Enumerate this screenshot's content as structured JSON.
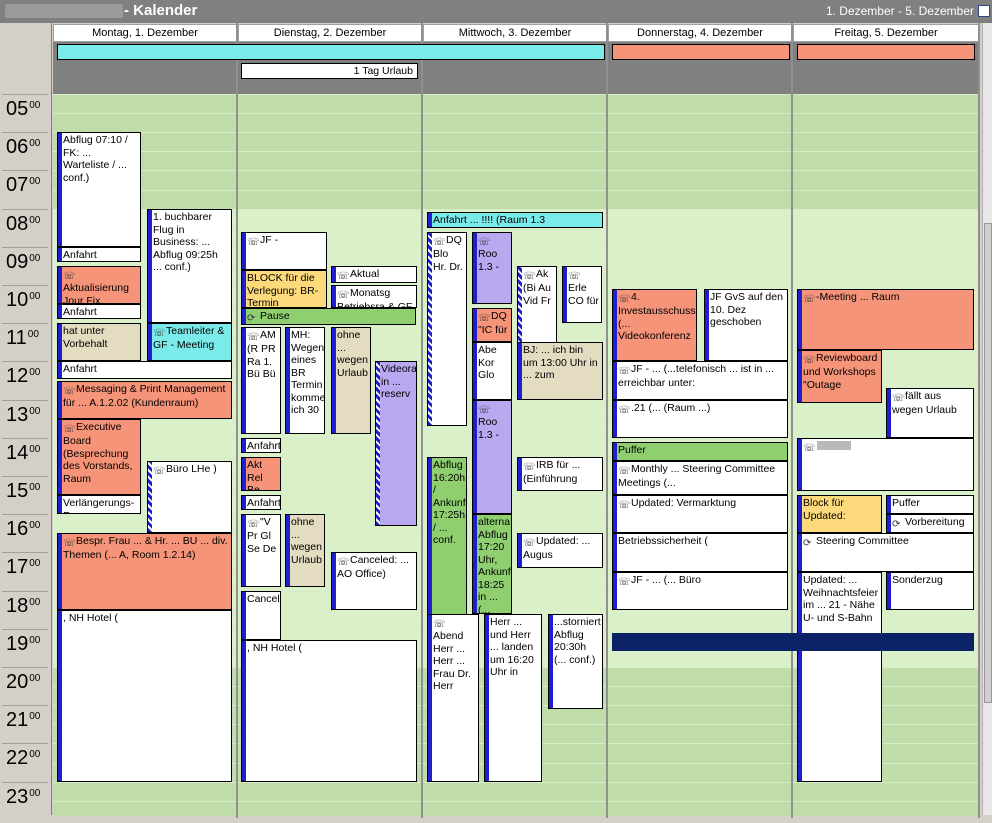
{
  "window": {
    "title": "- Kalender",
    "range": "1. Dezember - 5. Dezember"
  },
  "hours": [
    "05",
    "06",
    "07",
    "08",
    "09",
    "10",
    "11",
    "12",
    "13",
    "14",
    "15",
    "16",
    "17",
    "18",
    "19",
    "20",
    "21",
    "22",
    "23"
  ],
  "days": [
    {
      "header": "Montag, 1. Dezember"
    },
    {
      "header": "Dienstag, 2. Dezember"
    },
    {
      "header": "Mittwoch, 3. Dezember"
    },
    {
      "header": "Donnerstag, 4. Dezember"
    },
    {
      "header": "Freitag, 5. Dezember"
    }
  ],
  "allday": {
    "urlaub": "1 Tag Urlaub"
  },
  "events": {
    "mo_abflug": "Abflug 07:10 / FK: ... Warteliste / ... conf.)",
    "mo_anfahrt1": "Anfahrt",
    "mo_aktual": "Aktualisierung Jour Fix",
    "mo_anfahrt2": "Anfahrt",
    "mo_vorbehalt": "hat unter Vorbehalt",
    "mo_anfahrt3": "Anfahrt",
    "mo_messaging": "Messaging & Print Management für ... A.1.2.02 (Kundenraum)",
    "mo_board": "Executive Board (Besprechung des Vorstands, Raum",
    "mo_verl": "Verlängerungs-R",
    "mo_bespr": "Bespr. Frau ... & Hr. ... BU ... div. Themen (... A, Room 1.2.14)",
    "mo_hotel": ", NH Hotel (",
    "mo2_flug": "1. buchbarer Flug in Business: ... Abflug 09:25h ... conf.)",
    "mo2_team": "Teamleiter & GF - Meeting",
    "mo2_buero": "Büro LHe )",
    "di_jf": "JF -",
    "di_block": "BLOCK für die Verlegung: BR-Termin",
    "di_pause": "Pause",
    "di_am": "AM (R PR Ra 1. Bü Bü",
    "di_mh": "MH: Wegen eines BR Termin kommen ich 30",
    "di_ohne1": "ohne ... wegen Urlaub",
    "di_aktual": "Aktual",
    "di_monat": "Monatsg Betriebsra & GF",
    "di_video": "Videoraum in ... reserv",
    "di_anfahrt1": "Anfahrt",
    "di_akt2": "Akt Rel Be",
    "di_anfahrt2": "Anfahrt",
    "di_v": "\"V Pr Gl Se De",
    "di_ohne2": "ohne ... wegen Urlaub",
    "di_cancel": "Cancel",
    "di_canceled": "Canceled: ... AO Office)",
    "di_hotel": ", NH Hotel (",
    "mi_anfahrt": "Anfahrt ... !!!! (Raum 1.3",
    "mi_dq1": "DQ Blo Hr. Dr.",
    "mi_room1": "Roo 1.3 -",
    "mi_ak": "Ak (Bi Au Vid Fr",
    "mi_erl": "Erle CO für",
    "mi_dq2": "DQ \"IC für",
    "mi_abe": "Abe Kor Glo",
    "mi_bj": "BJ: ... ich bin um 13:00 Uhr in ... zum",
    "mi_room2": "Roo 1.3 -",
    "mi_abflug": "Abflug 16:20h / Ankunft 17:25h / ... conf.",
    "mi_alt": "alterna Abflug 17:20 Uhr, Ankunf 18:25 in ... (... conf)",
    "mi_irb": "IRB für ... (Einführung",
    "mi_updated": "Updated: ... Augus",
    "mi_abend": "Abend Herr ... Herr ... Frau Dr. Herr",
    "mi_herr": "Herr ... und Herr ... landen um 16:20 Uhr in",
    "mi_storn": "...storniert Abflug 20:30h (... conf.)",
    "do_invest": "4. Investausschuss (... Videokonferenz",
    "do_jfgvs": "JF GvS auf den 10. Dez geschoben",
    "do_jf1": "JF - ... (...telefonisch ... ist in ... erreichbar unter:",
    "do_raum": ".21 (... (Raum ...)",
    "do_puffer": "Puffer",
    "do_monthly": "Monthly ... Steering Committee Meetings (...",
    "do_updated": "Updated: Vermarktung",
    "do_betrieb": "Betriebssicherheit (",
    "do_jf2": "JF - ... (... Büro",
    "fr_meeting": "-Meeting ... Raum",
    "fr_review": "Reviewboard und Workshops \"Outage",
    "fr_faellt": "fällt aus wegen Urlaub",
    "fr_block": "Block für Updated:",
    "fr_puffer": "Puffer",
    "fr_vorb": "Vorbereitung",
    "fr_steer": "Steering Committee",
    "fr_updated": "Updated: ... Weihnachtsfeier im ... 21 - Nähe U- und S-Bahn",
    "fr_sonder": "Sonderzug"
  },
  "colors": {
    "salmon": "#f6947a",
    "cyan": "#7aeaea",
    "green": "#90cf70",
    "tan": "#e4dcc0",
    "purple": "#b8a8f0",
    "yellow": "#fcd97a",
    "strip": "#1f1fcf",
    "grid": "#c0dca8",
    "gridFree": "#daf0c8"
  }
}
